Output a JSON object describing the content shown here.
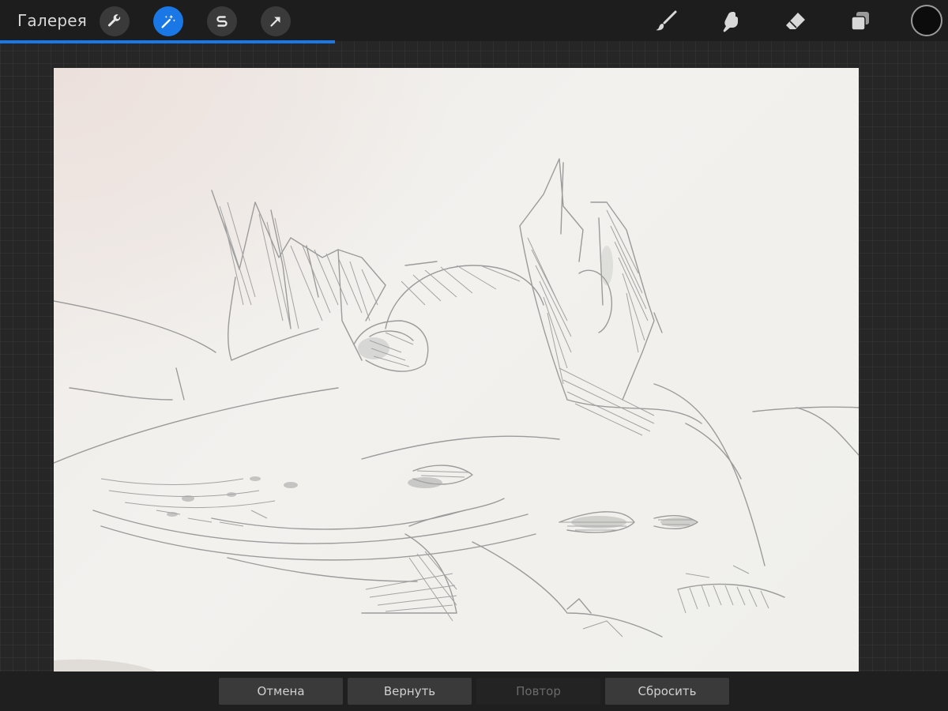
{
  "toolbar": {
    "gallery_label": "Галерея",
    "left_tools": [
      {
        "icon": "wrench-icon",
        "active": false
      },
      {
        "icon": "magic-wand-icon",
        "active": true
      },
      {
        "icon": "selection-s-icon",
        "active": false
      },
      {
        "icon": "transform-arrow-icon",
        "active": false
      }
    ],
    "right_tools": [
      "brush-icon",
      "smudge-icon",
      "eraser-icon",
      "layers-icon"
    ],
    "current_color": "#0c0c0c",
    "accent_color": "#1a78e6"
  },
  "progress": {
    "fraction": 0.353
  },
  "bottom_bar": {
    "cancel_label": "Отмена",
    "revert_label": "Вернуть",
    "redo_label": "Повтор",
    "reset_label": "Сбросить"
  }
}
